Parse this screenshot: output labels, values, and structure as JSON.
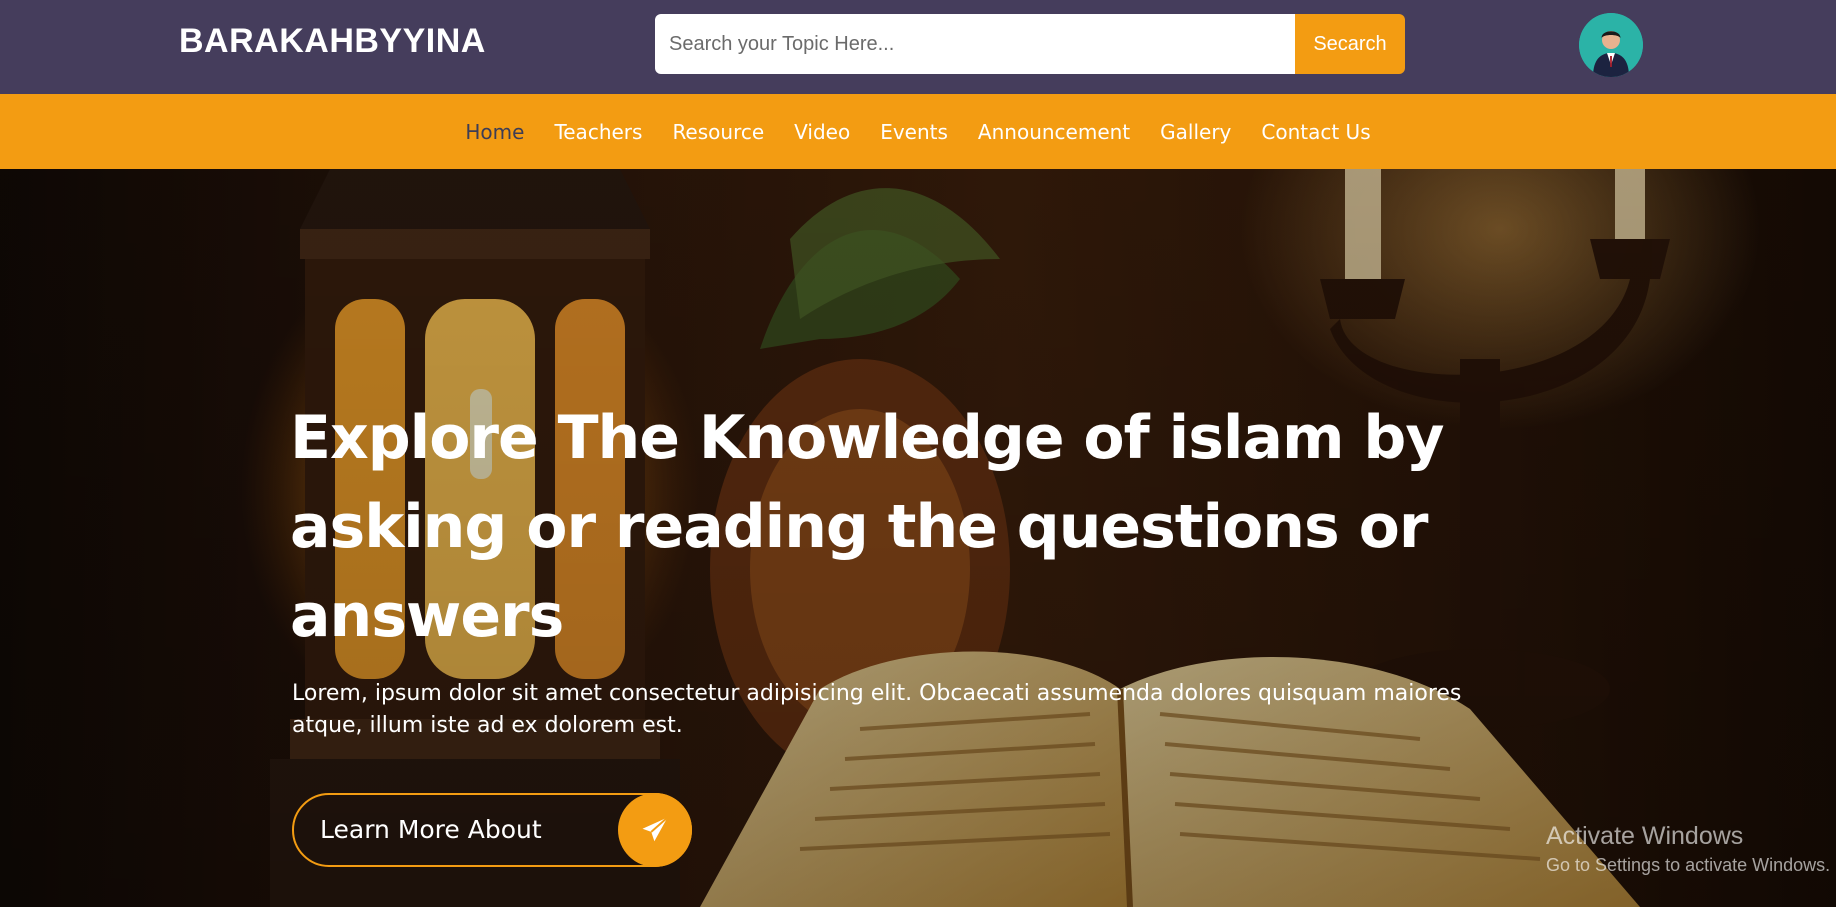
{
  "header": {
    "brand": "BARAKAHBYYINA",
    "search": {
      "placeholder": "Search your Topic Here...",
      "value": "",
      "button_label": "Secarch"
    }
  },
  "nav": {
    "items": [
      {
        "label": "Home",
        "active": true
      },
      {
        "label": "Teachers"
      },
      {
        "label": "Resource"
      },
      {
        "label": "Video"
      },
      {
        "label": "Events"
      },
      {
        "label": "Announcement"
      },
      {
        "label": "Gallery"
      },
      {
        "label": "Contact Us"
      }
    ]
  },
  "hero": {
    "title": "Explore The Knowledge of islam by asking or reading the questions or answers",
    "text": "Lorem, ipsum dolor sit amet consectetur adipisicing elit. Obcaecati assumenda dolores quisquam maiores atque, illum iste ad ex dolorem est.",
    "cta_label": "Learn More About",
    "cta_icon": "paper-plane-icon"
  },
  "watermark": {
    "title": "Activate Windows",
    "subtitle": "Go to Settings to activate Windows."
  },
  "colors": {
    "header_bg": "#453d5c",
    "nav_bg": "#f39c12",
    "accent": "#f39c12",
    "nav_active": "#3d3d55"
  }
}
